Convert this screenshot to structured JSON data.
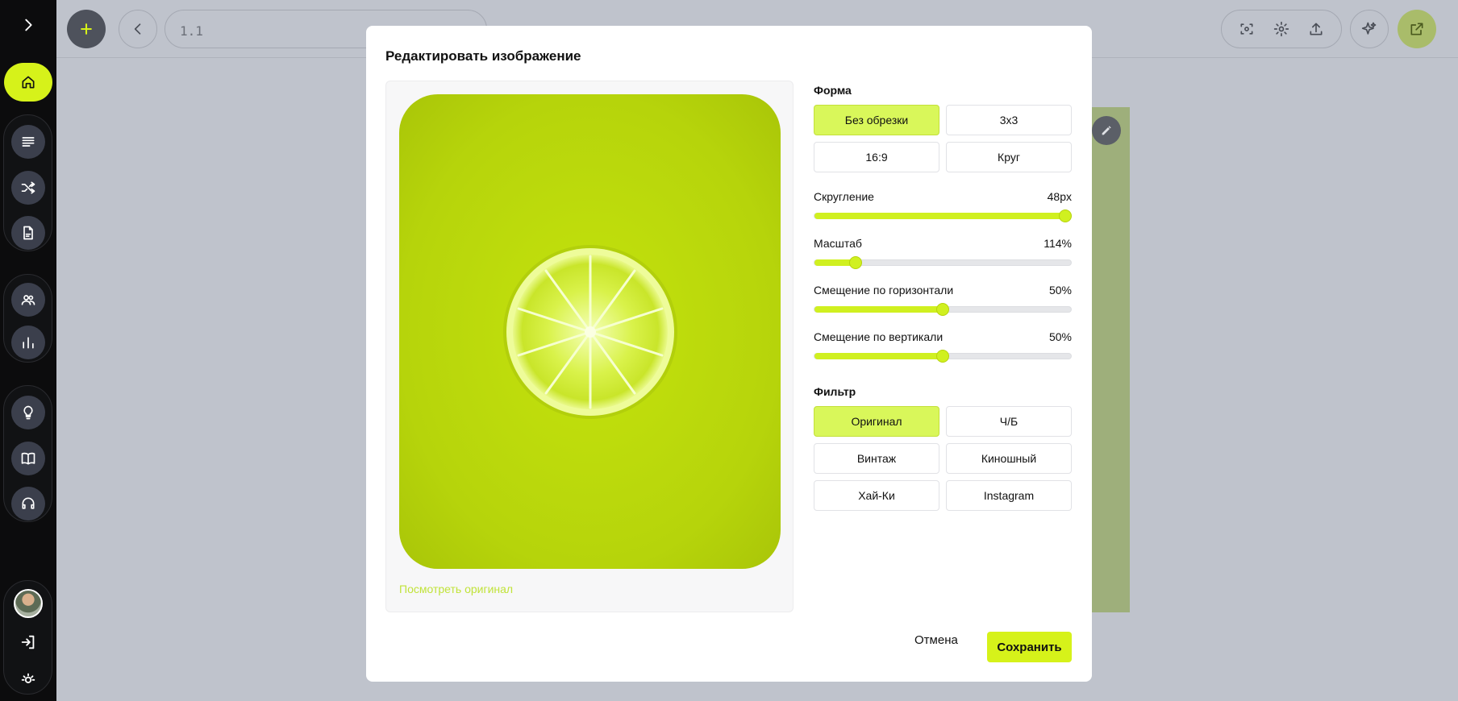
{
  "topbar": {
    "page_field": "1.1"
  },
  "modal": {
    "title": "Редактировать изображение",
    "view_original": "Посмотреть оригинал",
    "shape": {
      "label": "Форма",
      "options": [
        "Без обрезки",
        "3х3",
        "16:9",
        "Круг"
      ],
      "selected": "Без обрезки"
    },
    "sliders": [
      {
        "label": "Скругление",
        "value_text": "48px",
        "level": 1.0
      },
      {
        "label": "Масштаб",
        "value_text": "114%",
        "level": 0.16
      },
      {
        "label": "Смещение по горизонтали",
        "value_text": "50%",
        "level": 0.5
      },
      {
        "label": "Смещение по вертикали",
        "value_text": "50%",
        "level": 0.5
      }
    ],
    "filter": {
      "label": "Фильтр",
      "options": [
        "Оригинал",
        "Ч/Б",
        "Винтаж",
        "Киношный",
        "Хай-Ки",
        "Instagram"
      ],
      "selected": "Оригинал"
    },
    "cancel_label": "Отмена",
    "save_label": "Сохранить"
  },
  "colors": {
    "accent": "#d6f21a",
    "sidebar_bg": "#0c0c0d",
    "overlay_bg": "#bfc3cc",
    "link": "#c1e33a"
  }
}
